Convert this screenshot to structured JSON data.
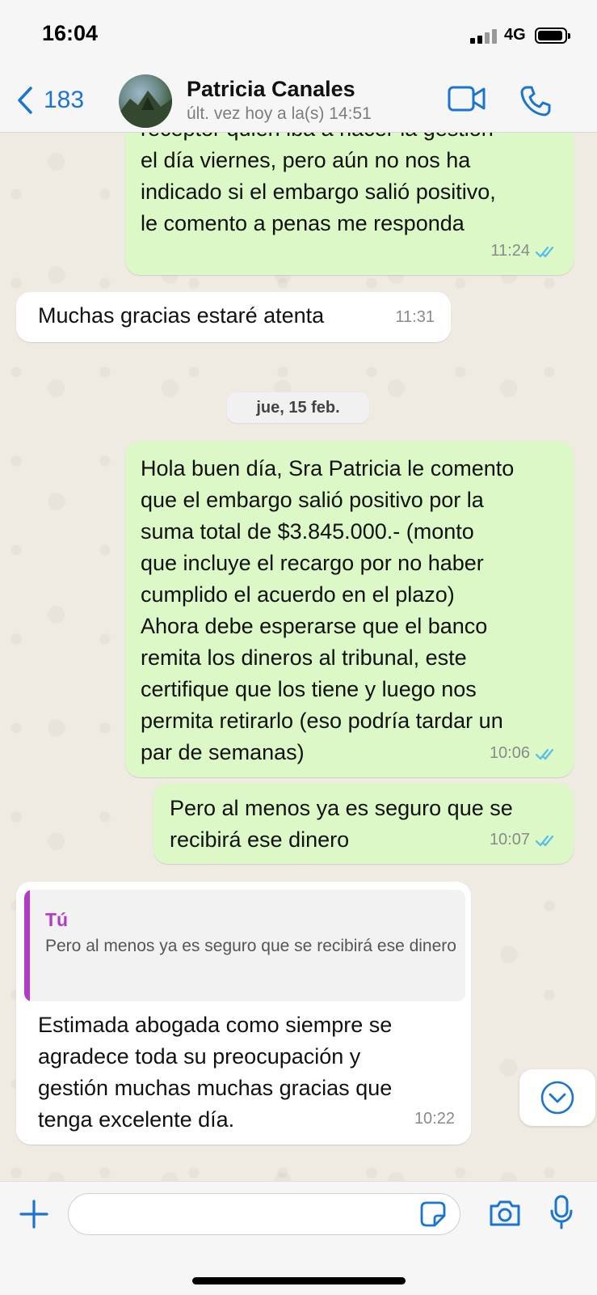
{
  "status_bar": {
    "time": "16:04",
    "network": "4G"
  },
  "header": {
    "back_count": "183",
    "contact_name": "Patricia Canales",
    "contact_status": "últ. vez hoy a la(s) 14:51"
  },
  "messages": [
    {
      "direction": "outgoing",
      "text": "receptor quien iba a hacer la gestión\nel día viernes, pero aún no nos ha\nindicado si el embargo salió positivo,\nle comento a penas me responda",
      "time": "11:24",
      "read": true
    },
    {
      "direction": "incoming",
      "text": "Muchas gracias estaré atenta",
      "time": "11:31"
    },
    {
      "direction": "outgoing",
      "text": "Hola buen día, Sra Patricia le comento\nque el embargo salió positivo por la\nsuma total de $3.845.000.- (monto\nque incluye el recargo por no haber\ncumplido el acuerdo en el plazo)\nAhora debe esperarse que el banco\nremita los dineros al tribunal, este\ncertifique que los tiene y luego nos\npermita retirarlo (eso podría tardar un\npar de semanas)",
      "time": "10:06",
      "read": true
    },
    {
      "direction": "outgoing",
      "text": "Pero al menos ya es seguro que se\nrecibirá ese dinero",
      "time": "10:07",
      "read": true
    },
    {
      "direction": "incoming",
      "reply_to": {
        "author": "Tú",
        "text": "Pero al menos ya es seguro que se recibirá ese dinero"
      },
      "text": "Estimada abogada como siempre se\nagradece toda su preocupación y\ngestión muchas muchas gracias que\ntenga excelente día.",
      "time": "10:22"
    }
  ],
  "date_separator": "jue, 15 feb.",
  "input": {
    "placeholder": "",
    "value": ""
  },
  "colors": {
    "accent": "#1b75d0",
    "outgoing_bubble": "#dcf8c6",
    "incoming_bubble": "#ffffff",
    "reply_author": "#b23bc6",
    "read_ticks": "#53bdeb"
  },
  "icons": [
    "back-chevron-icon",
    "video-call-icon",
    "phone-icon",
    "read-ticks-icon",
    "chevron-down-icon",
    "plus-icon",
    "sticker-icon",
    "camera-icon",
    "microphone-icon"
  ]
}
